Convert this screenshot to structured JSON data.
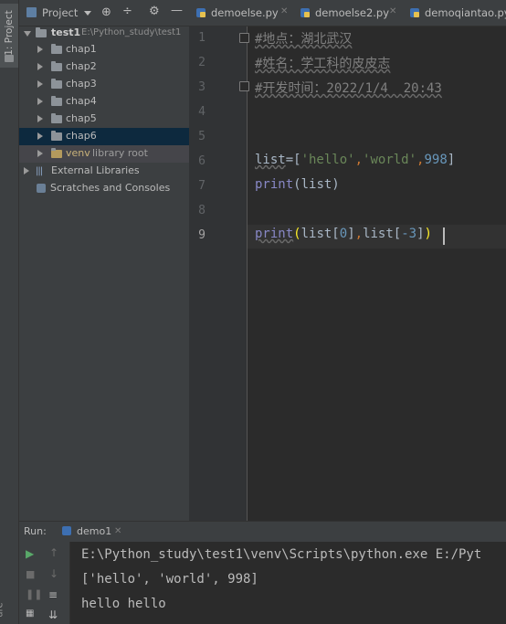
{
  "tool_window": {
    "project_tab_label": "1: Project",
    "bottom_label": "ure"
  },
  "project_panel": {
    "title": "Project",
    "tree": {
      "root": {
        "name": "test1",
        "path": "E:\\Python_study\\test1"
      },
      "folders": [
        "chap1",
        "chap2",
        "chap3",
        "chap4",
        "chap5",
        "chap6"
      ],
      "selected": "chap6",
      "venv": {
        "name": "venv",
        "note": "library root"
      },
      "external": "External Libraries",
      "scratches": "Scratches and Consoles"
    }
  },
  "tabs": [
    {
      "label": "demoelse.py"
    },
    {
      "label": "demoelse2.py"
    },
    {
      "label": "demoqiantao.py"
    }
  ],
  "editor": {
    "line_numbers": [
      "1",
      "2",
      "3",
      "4",
      "5",
      "6",
      "7",
      "8",
      "9"
    ],
    "current_line": "9",
    "lines": {
      "l1": "#地点：湖北武汉",
      "l2": "#姓名：学工科的皮皮志",
      "l3": "#开发时间：2022/1/4  20:43",
      "l6_list": "list",
      "l6_eq": "=[",
      "l6_s1": "'hello'",
      "l6_c1": ",",
      "l6_s2": "'world'",
      "l6_c2": ",",
      "l6_n": "998",
      "l6_end": "]",
      "l7_fn": "print",
      "l7_arg": "(list)",
      "l9_fn": "print",
      "l9_open": "(",
      "l9_a": "list[",
      "l9_i0": "0",
      "l9_b": "]",
      "l9_comma": ",",
      "l9_c": "list[",
      "l9_i1": "-3",
      "l9_d": "]",
      "l9_close": ")"
    }
  },
  "run_panel": {
    "label": "Run:",
    "config": "demo1",
    "output": [
      "E:\\Python_study\\test1\\venv\\Scripts\\python.exe E:/Pyt",
      "['hello', 'world', 998]",
      "hello hello"
    ]
  },
  "colors": {
    "background": "#2b2b2b",
    "panel": "#3c3f41",
    "selection": "#0d293e",
    "comment": "#808080",
    "string": "#6a8759",
    "number": "#6897bb",
    "builtin": "#8888c6"
  }
}
